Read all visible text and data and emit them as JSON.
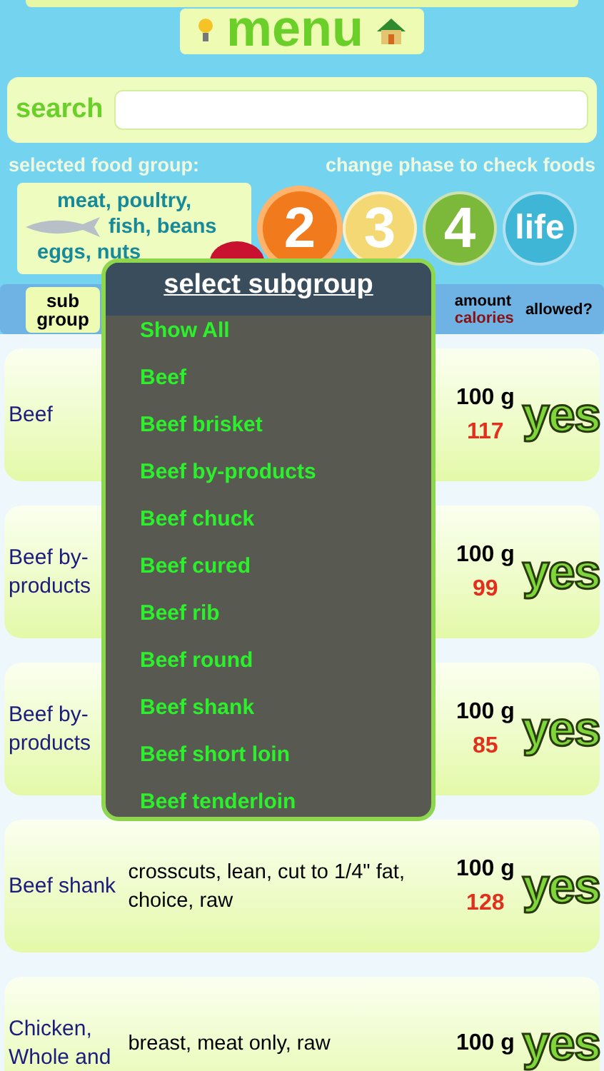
{
  "menu_button": {
    "label": "menu"
  },
  "search": {
    "label": "search"
  },
  "food_group": {
    "heading": "selected food group:",
    "lines": [
      "meat, poultry,",
      "fish, beans",
      "eggs, nuts"
    ]
  },
  "phases": {
    "heading": "change phase to check foods",
    "items": [
      {
        "label": "2",
        "color": "#f07a1c",
        "selected": true
      },
      {
        "label": "3",
        "color": "#f3d873",
        "selected": false
      },
      {
        "label": "4",
        "color": "#7cb83a",
        "selected": false
      },
      {
        "label": "life",
        "color": "#3fb6d6",
        "selected": false
      }
    ]
  },
  "table_header": {
    "subgroup_button": "sub group",
    "amount": "amount",
    "calories": "calories",
    "allowed": "allowed?"
  },
  "rows": [
    {
      "subgroup": "Beef",
      "amount": "100 g",
      "calories": "117",
      "allowed": "yes"
    },
    {
      "subgroup": "Beef by-products",
      "amount": "100 g",
      "calories": "99",
      "allowed": "yes"
    },
    {
      "subgroup": "Beef by-products",
      "amount": "100 g",
      "calories": "85",
      "allowed": "yes"
    },
    {
      "subgroup": "Beef shank",
      "food": "crosscuts, lean, cut to 1/4\" fat, choice, raw",
      "amount": "100 g",
      "calories": "128",
      "allowed": "yes"
    },
    {
      "subgroup": "Chicken, Whole and",
      "food": "breast, meat only, raw",
      "amount": "100 g",
      "allowed": "yes"
    }
  ],
  "popup": {
    "title": "select subgroup",
    "items": [
      "Show All",
      "Beef",
      "Beef brisket",
      "Beef by-products",
      "Beef chuck",
      "Beef cured",
      "Beef rib",
      "Beef round",
      "Beef shank",
      "Beef short loin",
      "Beef tenderloin"
    ]
  }
}
